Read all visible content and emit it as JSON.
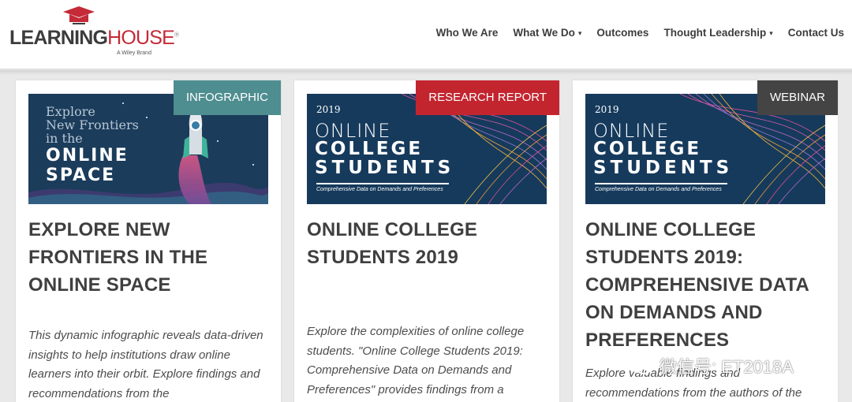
{
  "logo": {
    "text_part1": "LEARNING",
    "text_part2": "HOUSE",
    "tm": "®",
    "sub": "A Wiley Brand"
  },
  "nav": {
    "items": [
      {
        "label": "Who We Are"
      },
      {
        "label": "What We Do",
        "caret": "▾"
      },
      {
        "label": "Outcomes"
      },
      {
        "label": "Thought Leadership",
        "caret": "▾"
      },
      {
        "label": "Contact Us"
      }
    ]
  },
  "cards": [
    {
      "badge": "INFOGRAPHIC",
      "image": {
        "line1": "Explore",
        "line2": "New Frontiers",
        "line3": "in the",
        "line4": "ONLINE",
        "line5": "SPACE"
      },
      "title": "EXPLORE NEW FRONTIERS IN THE ONLINE SPACE",
      "description": "This dynamic infographic reveals data-driven insights to help institutions draw online learners into their orbit. Explore findings and recommendations from the"
    },
    {
      "badge": "RESEARCH REPORT",
      "image": {
        "year": "2019",
        "line1": "ONLINE",
        "line2": "COLLEGE",
        "line3": "STUDENTS",
        "caption": "Comprehensive Data on Demands and Preferences"
      },
      "title": "ONLINE COLLEGE STUDENTS 2019",
      "description": "Explore the complexities of online college students. \"Online College Students 2019: Comprehensive Data on Demands and Preferences\" provides findings from a"
    },
    {
      "badge": "WEBINAR",
      "image": {
        "year": "2019",
        "line1": "ONLINE",
        "line2": "COLLEGE",
        "line3": "STUDENTS",
        "caption": "Comprehensive Data on Demands and Preferences"
      },
      "title": "ONLINE COLLEGE STUDENTS 2019: COMPREHENSIVE DATA ON DEMANDS AND PREFERENCES",
      "description": "Explore valuable findings and recommendations from the authors of the"
    }
  ],
  "watermark": "微信号: ET2018A",
  "colors": {
    "brand_red": "#c42a37",
    "badge_infographic": "#4e8d90",
    "badge_research": "#c3252f",
    "badge_webinar": "#444444",
    "image_navy": "#163a5c"
  }
}
